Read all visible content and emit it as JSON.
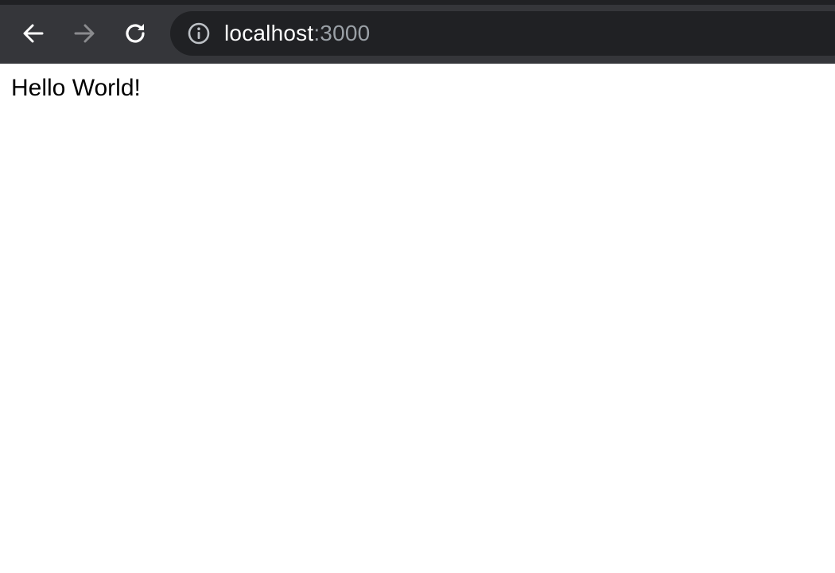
{
  "browser": {
    "address_bar": {
      "host": "localhost",
      "port": ":3000",
      "info_icon": "info-icon"
    },
    "nav": {
      "back_icon": "arrow-left-icon",
      "forward_icon": "arrow-right-icon",
      "reload_icon": "reload-icon"
    },
    "colors": {
      "toolbar": "#35363a",
      "omnibox": "#202124",
      "icon_active": "#ffffff",
      "icon_disabled": "#8a8b8e",
      "port_text": "#9aa0a6"
    }
  },
  "page": {
    "text": "Hello World!"
  }
}
